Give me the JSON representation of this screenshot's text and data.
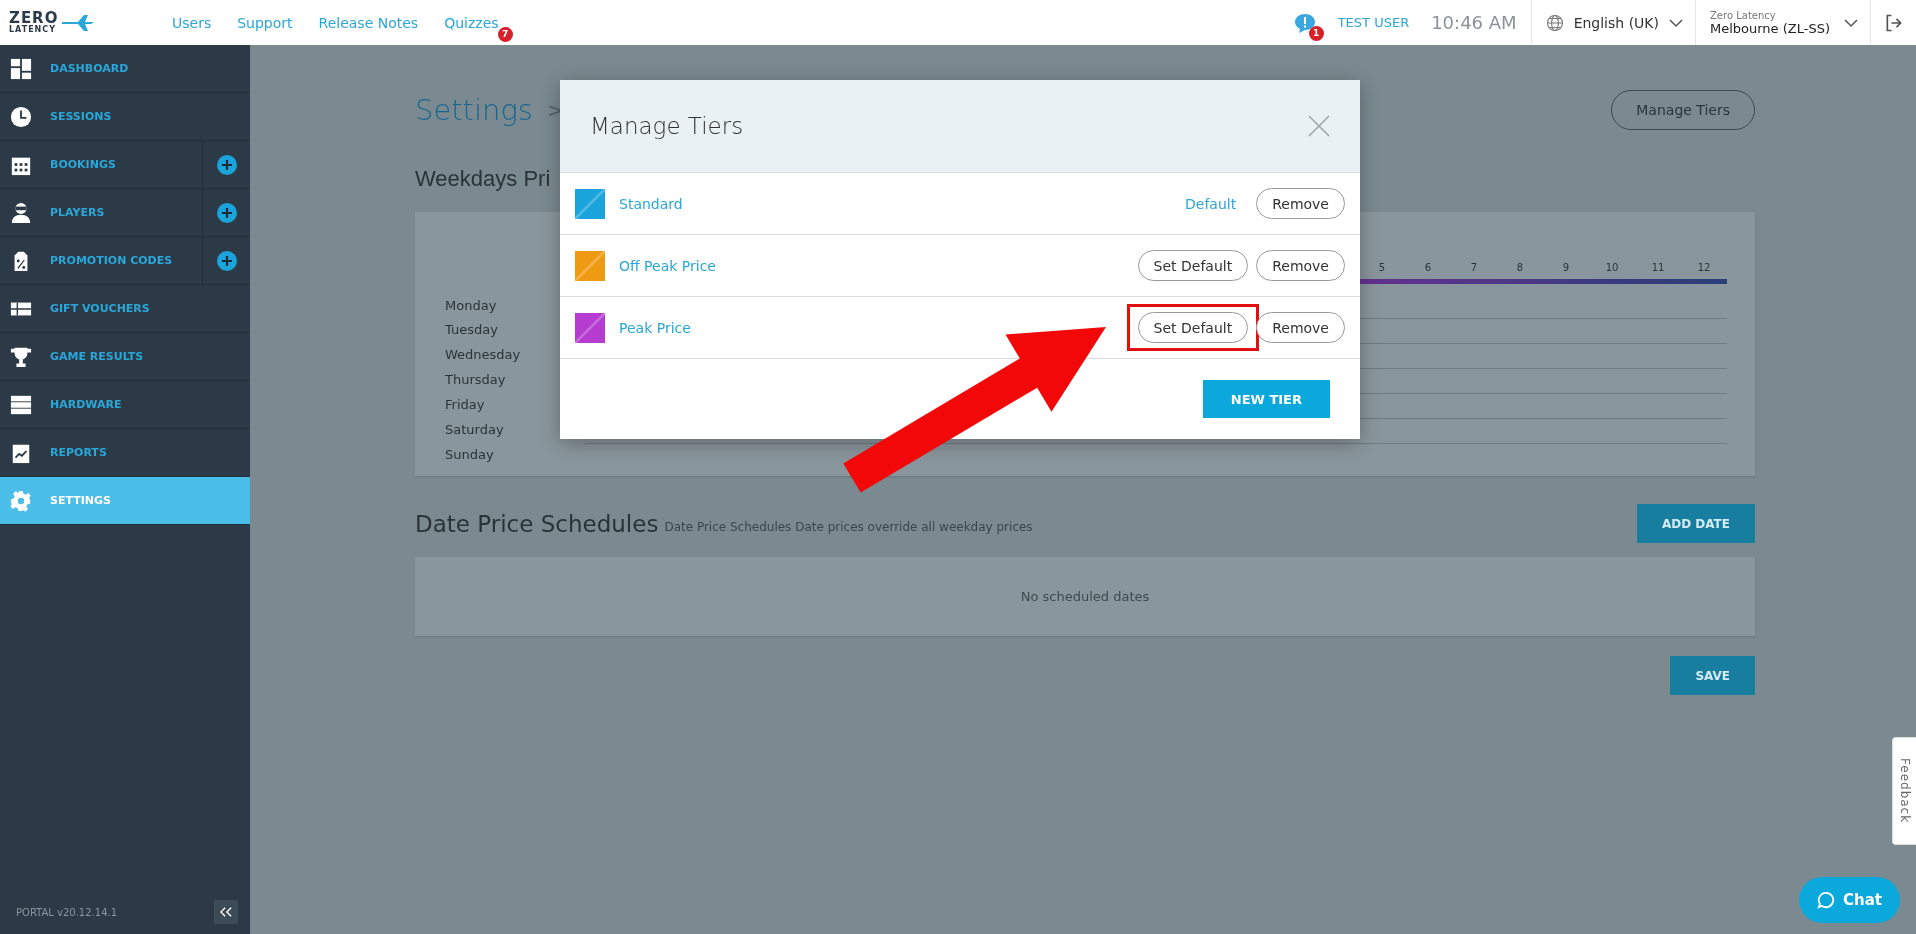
{
  "top_bar": {
    "logo": {
      "line_1": "ZERO",
      "line_2": "LATENCY"
    },
    "nav": [
      {
        "label": "Users"
      },
      {
        "label": "Support"
      },
      {
        "label": "Release Notes"
      },
      {
        "label": "Quizzes",
        "badge": "7"
      }
    ],
    "notifications": {
      "badge": "1"
    },
    "user": "TEST USER",
    "time": "10:46 AM",
    "language": "English (UK)",
    "site": {
      "company": "Zero Latency",
      "location": "Melbourne (ZL-SS)"
    }
  },
  "sidebar": {
    "items": [
      {
        "label": "DASHBOARD",
        "selected": false,
        "has_add": false
      },
      {
        "label": "SESSIONS",
        "selected": false,
        "has_add": false
      },
      {
        "label": "BOOKINGS",
        "selected": false,
        "has_add": true
      },
      {
        "label": "PLAYERS",
        "selected": false,
        "has_add": true
      },
      {
        "label": "PROMOTION CODES",
        "selected": false,
        "has_add": true
      },
      {
        "label": "GIFT VOUCHERS",
        "selected": false,
        "has_add": false
      },
      {
        "label": "GAME RESULTS",
        "selected": false,
        "has_add": false
      },
      {
        "label": "HARDWARE",
        "selected": false,
        "has_add": false
      },
      {
        "label": "REPORTS",
        "selected": false,
        "has_add": false
      },
      {
        "label": "SETTINGS",
        "selected": true,
        "has_add": false
      }
    ],
    "version": "PORTAL v20.12.14.1"
  },
  "page": {
    "breadcrumb": "Settings",
    "breadcrumb_separator": ">",
    "manage_tiers_button": "Manage Tiers",
    "weekdays_title": "Weekdays Pri",
    "hours": [
      "5",
      "6",
      "7",
      "8",
      "9",
      "10",
      "11",
      "12"
    ],
    "days": [
      "Monday",
      "Tuesday",
      "Wednesday",
      "Thursday",
      "Friday",
      "Saturday",
      "Sunday"
    ],
    "date_schedules": {
      "title": "Date Price Schedules",
      "subtitle": "Date Price Schedules Date prices override all weekday prices",
      "add_button": "ADD DATE",
      "empty_text": "No scheduled dates"
    },
    "save_button": "SAVE"
  },
  "modal": {
    "title": "Manage Tiers",
    "tiers": [
      {
        "name": "Standard",
        "color": "#1ba3dc",
        "default": true,
        "default_text": "Default",
        "remove": "Remove",
        "highlighted": false
      },
      {
        "name": "Off Peak Price",
        "color": "#ee9a12",
        "default": false,
        "default_text": "Set Default",
        "remove": "Remove",
        "highlighted": false
      },
      {
        "name": "Peak Price",
        "color": "#b63bd1",
        "default": false,
        "default_text": "Set Default",
        "remove": "Remove",
        "highlighted": true
      }
    ],
    "new_button": "NEW TIER"
  },
  "feedback_tab": "Feedback",
  "chat_button": "Chat"
}
